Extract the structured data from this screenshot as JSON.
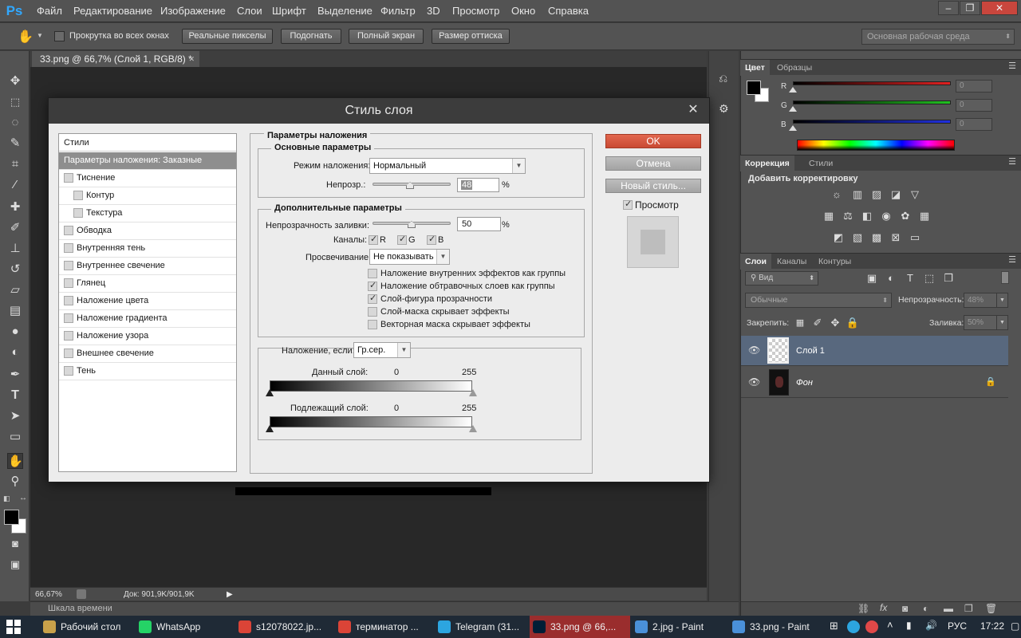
{
  "menu": {
    "logo": "Ps",
    "items": [
      "Файл",
      "Редактирование",
      "Изображение",
      "Слои",
      "Шрифт",
      "Выделение",
      "Фильтр",
      "3D",
      "Просмотр",
      "Окно",
      "Справка"
    ]
  },
  "window_controls": {
    "minimize": "–",
    "restore": "❐",
    "close": "✕"
  },
  "options_bar": {
    "scroll_all_label": "Прокрутка во всех окнах",
    "buttons": [
      "Реальные пикселы",
      "Подогнать",
      "Полный экран",
      "Размер оттиска"
    ],
    "workspace": "Основная рабочая среда"
  },
  "document": {
    "tab_title": "33.png @ 66,7% (Слой 1, RGB/8) *",
    "tab_close": "✕",
    "zoom": "66,67%",
    "doc_info": "Док: 901,9K/901,9K",
    "timeline_label": "Шкала времени"
  },
  "dialog": {
    "title": "Стиль слоя",
    "close": "✕",
    "styles_header": "Стили",
    "style_items": [
      {
        "label": "Параметры наложения: Заказные",
        "selected": true,
        "checkbox": false,
        "indent": false
      },
      {
        "label": "Тиснение",
        "checkbox": true,
        "indent": false
      },
      {
        "label": "Контур",
        "checkbox": true,
        "indent": true
      },
      {
        "label": "Текстура",
        "checkbox": true,
        "indent": true
      },
      {
        "label": "Обводка",
        "checkbox": true,
        "indent": false
      },
      {
        "label": "Внутренняя тень",
        "checkbox": true,
        "indent": false
      },
      {
        "label": "Внутреннее свечение",
        "checkbox": true,
        "indent": false
      },
      {
        "label": "Глянец",
        "checkbox": true,
        "indent": false
      },
      {
        "label": "Наложение цвета",
        "checkbox": true,
        "indent": false
      },
      {
        "label": "Наложение градиента",
        "checkbox": true,
        "indent": false
      },
      {
        "label": "Наложение узора",
        "checkbox": true,
        "indent": false
      },
      {
        "label": "Внешнее свечение",
        "checkbox": true,
        "indent": false
      },
      {
        "label": "Тень",
        "checkbox": true,
        "indent": false
      }
    ],
    "blending": {
      "title": "Параметры наложения",
      "general_title": "Основные параметры",
      "blend_mode_label": "Режим наложения:",
      "blend_mode_value": "Нормальный",
      "opacity_label": "Непрозр.:",
      "opacity_value": "48",
      "percent": "%",
      "advanced_title": "Дополнительные параметры",
      "fill_opacity_label": "Непрозрачность заливки:",
      "fill_opacity_value": "50",
      "channels_label": "Каналы:",
      "channels": [
        "R",
        "G",
        "B"
      ],
      "knockout_label": "Просвечивание:",
      "knockout_value": "Не показывать",
      "options": [
        {
          "label": "Наложение внутренних эффектов как группы",
          "checked": false
        },
        {
          "label": "Наложение обтравочных слоев как группы",
          "checked": true
        },
        {
          "label": "Слой-фигура прозрачности",
          "checked": true
        },
        {
          "label": "Слой-маска скрывает эффекты",
          "checked": false
        },
        {
          "label": "Векторная маска скрывает эффекты",
          "checked": false
        }
      ],
      "blend_if_label": "Наложение, если:",
      "blend_if_value": "Гр.сер.",
      "this_layer_label": "Данный слой:",
      "underlying_label": "Подлежащий слой:",
      "range_min": "0",
      "range_max": "255"
    },
    "buttons": {
      "ok": "OK",
      "cancel": "Отмена",
      "new_style": "Новый стиль..."
    },
    "preview_label": "Просмотр"
  },
  "color_panel": {
    "tabs": [
      "Цвет",
      "Образцы"
    ],
    "channels": [
      {
        "name": "R",
        "value": "0",
        "color": "#e02020"
      },
      {
        "name": "G",
        "value": "0",
        "color": "#20c020"
      },
      {
        "name": "B",
        "value": "0",
        "color": "#2030e0"
      }
    ]
  },
  "adjustments_panel": {
    "tabs": [
      "Коррекция",
      "Стили"
    ],
    "add_label": "Добавить корректировку"
  },
  "layers_panel": {
    "tabs": [
      "Слои",
      "Каналы",
      "Контуры"
    ],
    "filter_label": "Вид",
    "blend_mode": "Обычные",
    "opacity_label": "Непрозрачность:",
    "opacity_value": "48%",
    "lock_label": "Закрепить:",
    "fill_label": "Заливка:",
    "fill_value": "50%",
    "layers": [
      {
        "name": "Слой 1",
        "selected": true,
        "italic": false,
        "locked": false
      },
      {
        "name": "Фон",
        "selected": false,
        "italic": true,
        "locked": true
      }
    ]
  },
  "taskbar": {
    "items": [
      {
        "label": "Рабочий стол",
        "color": "#c9a14a",
        "icon": "folder-icon"
      },
      {
        "label": "WhatsApp",
        "color": "#25d366",
        "icon": "whatsapp-icon"
      },
      {
        "label": "s12078022.jp...",
        "color": "#db4437",
        "icon": "chrome-icon"
      },
      {
        "label": "терминатор ...",
        "color": "#db4437",
        "icon": "chrome-icon"
      },
      {
        "label": "Telegram (31...",
        "color": "#2ca5e0",
        "icon": "telegram-icon"
      },
      {
        "label": "33.png @ 66,...",
        "color": "#001e36",
        "icon": "photoshop-icon"
      },
      {
        "label": "2.jpg - Paint",
        "color": "#4a90d9",
        "icon": "paint-icon"
      },
      {
        "label": "33.png - Paint",
        "color": "#4a90d9",
        "icon": "paint-icon"
      }
    ],
    "language": "РУС",
    "time": "17:22"
  }
}
